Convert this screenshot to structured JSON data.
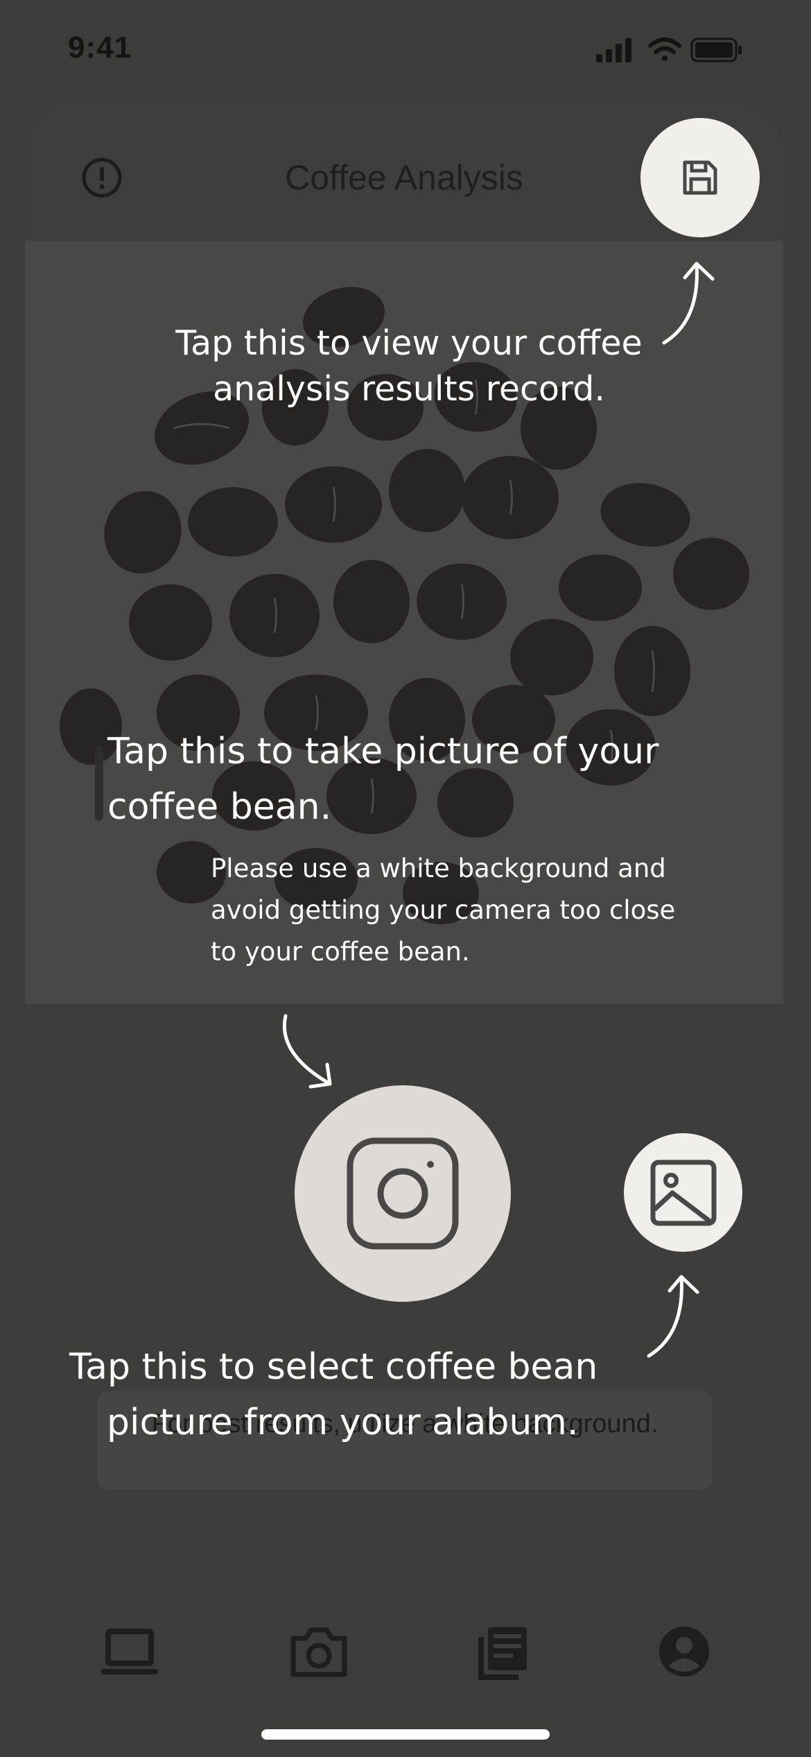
{
  "status_bar": {
    "time": "9:41"
  },
  "header": {
    "title": "Coffee Analysis"
  },
  "hint": {
    "text": "For best results, utilize a white background."
  },
  "tutorial": {
    "save_tip": "Tap this to view your coffee analysis results record.",
    "capture_tip": "Tap this to take picture of your coffee bean.",
    "capture_note": "Please use a white background and avoid getting your camera too close to your coffee bean.",
    "gallery_tip_line1": "Tap this to select coffee bean",
    "gallery_tip_line2": "picture from your alabum."
  },
  "icons": {
    "info": "info-icon",
    "save": "save-icon",
    "capture": "camera-icon",
    "gallery": "image-icon",
    "nav": [
      "laptop-icon",
      "camera-icon",
      "newspaper-icon",
      "account-icon"
    ]
  },
  "colors": {
    "overlay": "#3c3c3b",
    "button": "#f1efec",
    "text": "#ffffff"
  }
}
